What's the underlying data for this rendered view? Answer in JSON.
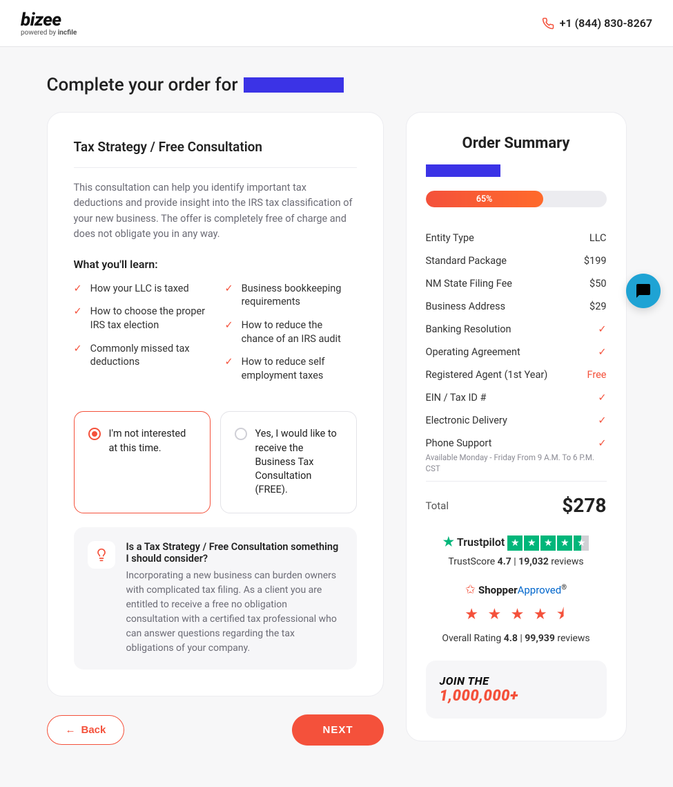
{
  "header": {
    "logo_main": "bizee",
    "logo_sub_prefix": "powered by ",
    "logo_sub_brand": "incfile",
    "phone": "+1 (844) 830-8267"
  },
  "page_title": "Complete your order for",
  "main": {
    "card_title": "Tax Strategy / Free Consultation",
    "description": "This consultation can help you identify important tax deductions and provide insight into the IRS tax classification of your new business. The offer is completely free of charge and does not obligate you in any way.",
    "learn_title": "What you'll learn:",
    "learn_left": [
      "How your LLC is taxed",
      "How to choose the proper IRS tax election",
      "Commonly missed tax deductions"
    ],
    "learn_right": [
      "Business bookkeeping requirements",
      "How to reduce the chance of an IRS audit",
      "How to reduce self employment taxes"
    ],
    "option_no": "I'm not interested at this time.",
    "option_yes": "Yes, I would like to receive the Business Tax Consultation (FREE).",
    "tip_question": "Is a Tax Strategy / Free Consultation something I should consider?",
    "tip_answer": "Incorporating a new business can burden owners with complicated tax filing. As a client you are entitled to receive a free no obligation consultation with a certified tax professional who can answer questions regarding the tax obligations of your company."
  },
  "nav": {
    "back": "Back",
    "next": "NEXT"
  },
  "summary": {
    "title": "Order Summary",
    "progress_percent": 65,
    "progress_label": "65%",
    "lines": [
      {
        "label": "Entity Type",
        "value": "LLC",
        "type": "text"
      },
      {
        "label": "Standard Package",
        "value": "$199",
        "type": "text"
      },
      {
        "label": "NM State Filing Fee",
        "value": "$50",
        "type": "text"
      },
      {
        "label": "Business Address",
        "value": "$29",
        "type": "text"
      },
      {
        "label": "Banking Resolution",
        "value": "",
        "type": "check"
      },
      {
        "label": "Operating Agreement",
        "value": "",
        "type": "check"
      },
      {
        "label": "Registered Agent (1st Year)",
        "value": "Free",
        "type": "free"
      },
      {
        "label": "EIN / Tax ID #",
        "value": "",
        "type": "check"
      },
      {
        "label": "Electronic Delivery",
        "value": "",
        "type": "check"
      },
      {
        "label": "Phone Support",
        "value": "",
        "type": "check"
      }
    ],
    "phone_support_note": "Available Monday - Friday From 9 A.M. To 6 P.M. CST",
    "total_label": "Total",
    "total_value": "$278"
  },
  "trustpilot": {
    "brand": "Trustpilot",
    "score_prefix": "TrustScore ",
    "score": "4.7",
    "sep": " | ",
    "reviews_count": "19,032",
    "reviews_suffix": " reviews"
  },
  "shopper": {
    "brand_bold": "Shopper",
    "brand_light": "Approved",
    "stars": "★ ★ ★ ★ ⯨",
    "line_prefix": "Overall Rating ",
    "rating": "4.8",
    "sep": " | ",
    "reviews_count": "99,939",
    "reviews_suffix": " reviews"
  },
  "join": {
    "line1": "JOIN THE",
    "line2": "1,000,000+"
  }
}
